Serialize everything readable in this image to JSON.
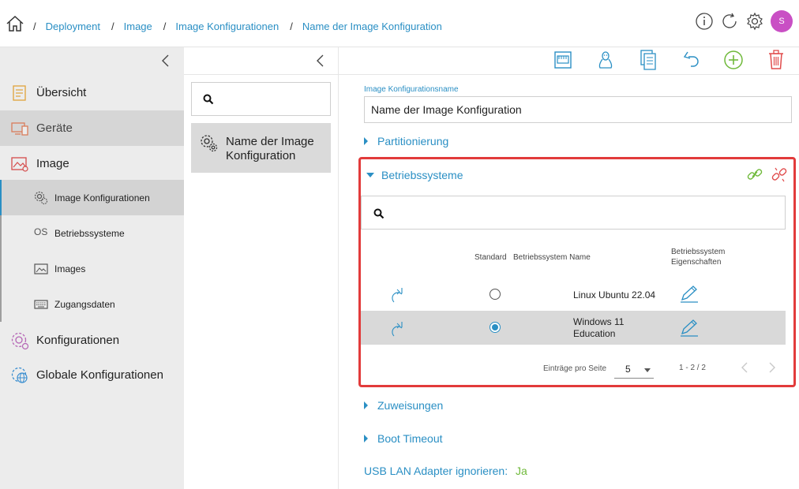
{
  "breadcrumb": {
    "items": [
      "Deployment",
      "Image",
      "Image Konfigurationen",
      "Name der Image Konfiguration"
    ],
    "separator": "/"
  },
  "user": {
    "avatar_initial": "S",
    "avatar_color": "#c94fc4"
  },
  "sidebar": {
    "items": [
      {
        "label": "Übersicht"
      },
      {
        "label": "Geräte"
      },
      {
        "label": "Image"
      },
      {
        "label": "Konfigurationen"
      },
      {
        "label": "Globale Konfigurationen"
      }
    ],
    "subitems": [
      {
        "label": "Image Konfigurationen",
        "icon_text": ""
      },
      {
        "label": "Betriebssysteme",
        "icon_text": "OS"
      },
      {
        "label": "Images",
        "icon_text": ""
      },
      {
        "label": "Zugangsdaten",
        "icon_text": ""
      }
    ]
  },
  "middle": {
    "card_label": "Name der Image Konfiguration"
  },
  "form": {
    "name_label": "Image Konfigurationsname",
    "name_value": "Name der Image Konfiguration"
  },
  "sections": {
    "partitionierung": "Partitionierung",
    "betriebssysteme": "Betriebssysteme",
    "zuweisungen": "Zuweisungen",
    "boot_timeout": "Boot Timeout"
  },
  "os_table": {
    "headers": {
      "standard": "Standard",
      "name": "Betriebssystem Name",
      "props_line1": "Betriebssystem",
      "props_line2": "Eigenschaften"
    },
    "rows": [
      {
        "name": "Linux Ubuntu 22.04",
        "name_line2": "",
        "is_default": false
      },
      {
        "name": "Windows 11",
        "name_line2": "Education",
        "is_default": true
      }
    ],
    "pager": {
      "per_page_label": "Einträge pro Seite",
      "per_page_value": "5",
      "range": "1 - 2 / 2"
    }
  },
  "usb": {
    "label": "USB LAN Adapter ignorieren:",
    "value": "Ja"
  },
  "colors": {
    "accent": "#2a8fc4",
    "highlight_border": "#e23b3b",
    "success": "#6fb93a",
    "danger": "#e04b4b"
  }
}
